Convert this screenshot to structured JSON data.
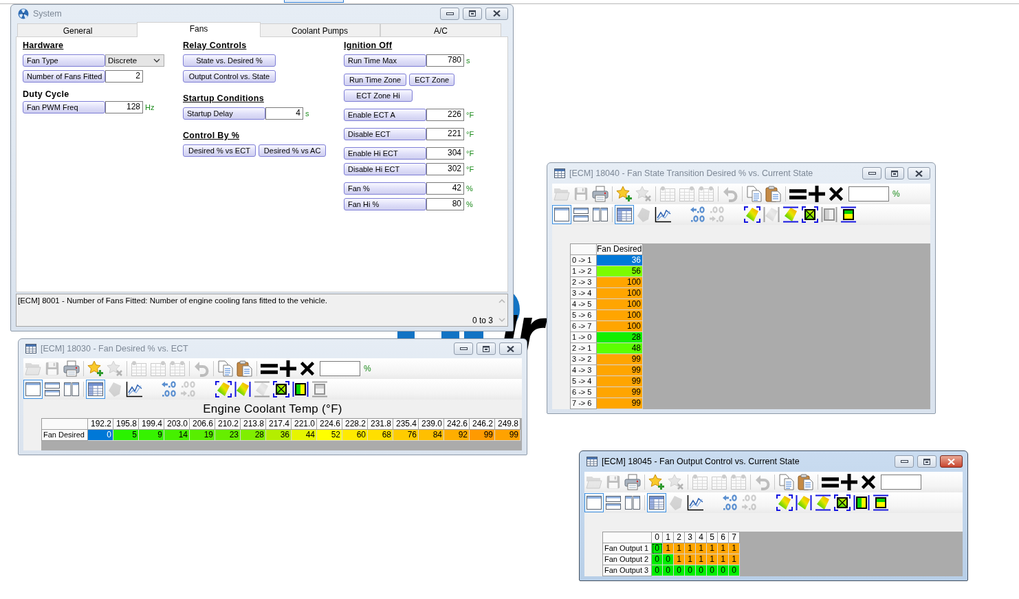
{
  "windows": [
    {
      "kind": "form",
      "title": "System",
      "active": false,
      "tabs": [
        {
          "label": "General",
          "selected": false
        },
        {
          "label": "Fans",
          "selected": true
        },
        {
          "label": "Coolant Pumps",
          "selected": false
        },
        {
          "label": "A/C",
          "selected": false
        }
      ],
      "columns": [
        {
          "groups": [
            {
              "heading": {
                "text": "Hardware",
                "underlined": true
              },
              "rows": [
                {
                  "kind": "dropdown",
                  "label": "Fan Type",
                  "value": "Discrete"
                },
                {
                  "kind": "field",
                  "label": "Number of Fans Fitted",
                  "value": "2"
                }
              ]
            },
            {
              "heading": {
                "text": "Duty Cycle",
                "underlined": false
              },
              "rows": [
                {
                  "kind": "field",
                  "label": "Fan PWM Freq",
                  "value": "128",
                  "unit": "Hz"
                }
              ]
            }
          ]
        },
        {
          "groups": [
            {
              "heading": {
                "text": "Relay Controls",
                "underlined": true
              },
              "rows": [
                {
                  "kind": "buttons",
                  "labels": [
                    "State vs. Desired %"
                  ]
                },
                {
                  "kind": "buttons",
                  "labels": [
                    "Output Control vs. State"
                  ]
                }
              ]
            },
            {
              "heading": {
                "text": "Startup Conditions",
                "underlined": true
              },
              "rows": [
                {
                  "kind": "field",
                  "label": "Startup Delay",
                  "value": "4",
                  "unit": "s"
                }
              ]
            },
            {
              "heading": {
                "text": "Control By %",
                "underlined": true
              },
              "rows": [
                {
                  "kind": "buttons",
                  "labels": [
                    "Desired % vs ECT",
                    "Desired % vs AC"
                  ]
                }
              ]
            }
          ]
        },
        {
          "groups": [
            {
              "heading": {
                "text": "Ignition Off",
                "underlined": true
              },
              "rows": [
                {
                  "kind": "field",
                  "label": "Run Time Max",
                  "value": "780",
                  "unit": "s"
                }
              ]
            },
            {
              "rows": [
                {
                  "kind": "buttons",
                  "labels": [
                    "Run Time Zone",
                    "ECT Zone"
                  ]
                },
                {
                  "kind": "buttons",
                  "labels": [
                    "ECT Zone Hi"
                  ]
                }
              ]
            },
            {
              "rows": [
                {
                  "kind": "field",
                  "label": "Enable ECT A",
                  "value": "226",
                  "unit": "°F"
                }
              ]
            },
            {
              "rows": [
                {
                  "kind": "field",
                  "label": "Disable ECT",
                  "value": "221",
                  "unit": "°F"
                }
              ]
            },
            {
              "rows": [
                {
                  "kind": "field",
                  "label": "Enable Hi ECT",
                  "value": "304",
                  "unit": "°F"
                },
                {
                  "kind": "field",
                  "label": "Disable Hi ECT",
                  "value": "302",
                  "unit": "°F"
                }
              ]
            },
            {
              "rows": [
                {
                  "kind": "field",
                  "label": "Fan %",
                  "value": "42",
                  "unit": "%"
                },
                {
                  "kind": "field",
                  "label": "Fan Hi %",
                  "value": "80",
                  "unit": "%"
                }
              ]
            }
          ]
        }
      ],
      "description": {
        "text": "[ECM] 8001 - Number of Fans Fitted: Number of engine cooling fans fitted to the vehicle.",
        "range": "0 to 3"
      }
    },
    {
      "kind": "table",
      "title": "[ECM] 18030 - Fan Desired % vs. ECT",
      "active": false,
      "toolbar_rows": [
        {
          "groups": [
            {
              "items": [
                {
                  "kind": "open",
                  "disabled": true
                },
                {
                  "kind": "save",
                  "disabled": true
                },
                {
                  "kind": "print",
                  "disabled": false
                }
              ]
            },
            {
              "items": [
                {
                  "kind": "add_favorite",
                  "disabled": false
                },
                {
                  "kind": "remove_favorite",
                  "disabled": true
                }
              ]
            },
            {
              "items": [
                {
                  "kind": "grid_a",
                  "disabled": true
                },
                {
                  "kind": "grid_b",
                  "disabled": true
                },
                {
                  "kind": "grid_c",
                  "disabled": true
                }
              ]
            },
            {
              "items": [
                {
                  "kind": "undo",
                  "disabled": true
                }
              ]
            },
            {
              "items": [
                {
                  "kind": "copy",
                  "disabled": false
                },
                {
                  "kind": "paste",
                  "disabled": false
                }
              ]
            },
            {
              "items": [
                {
                  "kind": "set",
                  "disabled": false
                },
                {
                  "kind": "add",
                  "disabled": false
                },
                {
                  "kind": "multiply",
                  "disabled": false
                },
                {
                  "kind": "input",
                  "disabled": false,
                  "unit": "%"
                }
              ]
            }
          ]
        },
        {
          "groups": [
            {
              "items": [
                {
                  "kind": "single_pane",
                  "disabled": false,
                  "selected": true
                },
                {
                  "kind": "stacked_panes",
                  "disabled": false,
                  "selected": false
                },
                {
                  "kind": "side_panes",
                  "disabled": false,
                  "selected": false
                }
              ]
            },
            {
              "items": [
                {
                  "kind": "table_view",
                  "disabled": false,
                  "selected": true
                },
                {
                  "kind": "surface_view",
                  "disabled": true,
                  "selected": false
                },
                {
                  "kind": "chart_view",
                  "disabled": false,
                  "selected": false
                }
              ]
            },
            {
              "items": [
                {
                  "kind": "decimal_more",
                  "disabled": false
                },
                {
                  "kind": "decimal_less",
                  "disabled": true
                }
              ]
            },
            {
              "items": [
                {
                  "kind": "fit_all",
                  "disabled": false
                },
                {
                  "kind": "fit_sides",
                  "disabled": false
                },
                {
                  "kind": "fit_top_bottom",
                  "disabled": true
                },
                {
                  "kind": "cross_box",
                  "disabled": false
                },
                {
                  "kind": "bar_sides",
                  "disabled": false
                },
                {
                  "kind": "bar_top_bottom",
                  "disabled": true
                }
              ]
            }
          ]
        }
      ],
      "axis_title": "Engine Coolant Temp (°F)",
      "table": {
        "columns": [
          "192.2",
          "195.8",
          "199.4",
          "203.0",
          "206.6",
          "210.2",
          "213.8",
          "217.4",
          "221.0",
          "224.6",
          "228.2",
          "231.8",
          "235.4",
          "239.0",
          "242.6",
          "246.2",
          "249.8"
        ],
        "rows": [
          {
            "label": "Fan Desired",
            "cells": [
              {
                "value": "0",
                "selected": true
              },
              {
                "value": "5",
                "color": "#2af200",
                "selected": false
              },
              {
                "value": "9",
                "color": "#36f200",
                "selected": false
              },
              {
                "value": "14",
                "color": "#46f000",
                "selected": false
              },
              {
                "value": "19",
                "color": "#58ee00",
                "selected": false
              },
              {
                "value": "23",
                "color": "#66ee00",
                "selected": false
              },
              {
                "value": "28",
                "color": "#80ee00",
                "selected": false
              },
              {
                "value": "36",
                "color": "#b4ee00",
                "selected": false
              },
              {
                "value": "44",
                "color": "#e6f500",
                "selected": false
              },
              {
                "value": "52",
                "color": "#ffff00",
                "selected": false
              },
              {
                "value": "60",
                "color": "#ffea00",
                "selected": false
              },
              {
                "value": "68",
                "color": "#ffdf00",
                "selected": false
              },
              {
                "value": "76",
                "color": "#ffcc00",
                "selected": false
              },
              {
                "value": "84",
                "color": "#ffbf00",
                "selected": false
              },
              {
                "value": "92",
                "color": "#ffae00",
                "selected": false
              },
              {
                "value": "99",
                "color": "#ff9a00",
                "selected": false
              },
              {
                "value": "99",
                "color": "#ffa200",
                "selected": false
              }
            ]
          }
        ]
      }
    },
    {
      "kind": "table",
      "title": "[ECM] 18040 - Fan State Transition Desired % vs. Current State",
      "active": false,
      "toolbar_rows": [
        {
          "groups": [
            {
              "items": [
                {
                  "kind": "open",
                  "disabled": true
                },
                {
                  "kind": "save",
                  "disabled": true
                },
                {
                  "kind": "print",
                  "disabled": false
                }
              ]
            },
            {
              "items": [
                {
                  "kind": "add_favorite",
                  "disabled": false
                },
                {
                  "kind": "remove_favorite",
                  "disabled": true
                }
              ]
            },
            {
              "items": [
                {
                  "kind": "grid_a",
                  "disabled": true
                },
                {
                  "kind": "grid_b",
                  "disabled": true
                },
                {
                  "kind": "grid_c",
                  "disabled": true
                }
              ]
            },
            {
              "items": [
                {
                  "kind": "undo",
                  "disabled": true
                }
              ]
            },
            {
              "items": [
                {
                  "kind": "copy",
                  "disabled": false
                },
                {
                  "kind": "paste",
                  "disabled": false
                }
              ]
            },
            {
              "items": [
                {
                  "kind": "set",
                  "disabled": false
                },
                {
                  "kind": "add",
                  "disabled": false
                },
                {
                  "kind": "multiply",
                  "disabled": false
                },
                {
                  "kind": "input",
                  "disabled": false,
                  "unit": "%"
                }
              ]
            }
          ]
        },
        {
          "groups": [
            {
              "items": [
                {
                  "kind": "single_pane",
                  "disabled": false,
                  "selected": true
                },
                {
                  "kind": "stacked_panes",
                  "disabled": false,
                  "selected": false
                },
                {
                  "kind": "side_panes",
                  "disabled": false,
                  "selected": false
                }
              ]
            },
            {
              "items": [
                {
                  "kind": "table_view",
                  "disabled": false,
                  "selected": true
                },
                {
                  "kind": "surface_view",
                  "disabled": true,
                  "selected": false
                },
                {
                  "kind": "chart_view",
                  "disabled": false,
                  "selected": false
                }
              ]
            },
            {
              "items": [
                {
                  "kind": "decimal_more",
                  "disabled": false
                },
                {
                  "kind": "decimal_less",
                  "disabled": true
                }
              ]
            },
            {
              "items": [
                {
                  "kind": "fit_all",
                  "disabled": false
                },
                {
                  "kind": "fit_sides",
                  "disabled": true
                },
                {
                  "kind": "fit_top_bottom",
                  "disabled": false
                },
                {
                  "kind": "cross_box",
                  "disabled": false
                },
                {
                  "kind": "bar_sides",
                  "disabled": true
                },
                {
                  "kind": "bar_top_bottom",
                  "disabled": false
                }
              ]
            }
          ]
        }
      ],
      "table": {
        "columns": [
          "Fan Desired"
        ],
        "rows": [
          {
            "label": "0 -> 1",
            "cells": [
              {
                "value": "36",
                "selected": true
              }
            ]
          },
          {
            "label": "1 -> 2",
            "cells": [
              {
                "value": "56",
                "color": "#7cfc00",
                "selected": false
              }
            ]
          },
          {
            "label": "2 -> 3",
            "cells": [
              {
                "value": "100",
                "color": "#ffa500",
                "selected": false
              }
            ]
          },
          {
            "label": "3 -> 4",
            "cells": [
              {
                "value": "100",
                "color": "#ffa500",
                "selected": false
              }
            ]
          },
          {
            "label": "4 -> 5",
            "cells": [
              {
                "value": "100",
                "color": "#ffa500",
                "selected": false
              }
            ]
          },
          {
            "label": "5 -> 6",
            "cells": [
              {
                "value": "100",
                "color": "#ffa500",
                "selected": false
              }
            ]
          },
          {
            "label": "6 -> 7",
            "cells": [
              {
                "value": "100",
                "color": "#ffa500",
                "selected": false
              }
            ]
          },
          {
            "label": "1 -> 0",
            "cells": [
              {
                "value": "28",
                "color": "#14ee00",
                "selected": false
              }
            ]
          },
          {
            "label": "2 -> 1",
            "cells": [
              {
                "value": "48",
                "color": "#5cff00",
                "selected": false
              }
            ]
          },
          {
            "label": "3 -> 2",
            "cells": [
              {
                "value": "99",
                "color": "#ffa500",
                "selected": false
              }
            ]
          },
          {
            "label": "4 -> 3",
            "cells": [
              {
                "value": "99",
                "color": "#ffa500",
                "selected": false
              }
            ]
          },
          {
            "label": "5 -> 4",
            "cells": [
              {
                "value": "99",
                "color": "#ffa500",
                "selected": false
              }
            ]
          },
          {
            "label": "6 -> 5",
            "cells": [
              {
                "value": "99",
                "color": "#ffa500",
                "selected": false
              }
            ]
          },
          {
            "label": "7 -> 6",
            "cells": [
              {
                "value": "99",
                "color": "#ffa500",
                "selected": false
              }
            ]
          }
        ]
      }
    },
    {
      "kind": "table",
      "title": "[ECM] 18045 - Fan Output Control vs. Current State",
      "active": true,
      "toolbar_rows": [
        {
          "groups": [
            {
              "items": [
                {
                  "kind": "open",
                  "disabled": true
                },
                {
                  "kind": "save",
                  "disabled": true
                },
                {
                  "kind": "print",
                  "disabled": false
                }
              ]
            },
            {
              "items": [
                {
                  "kind": "add_favorite",
                  "disabled": false
                },
                {
                  "kind": "remove_favorite",
                  "disabled": true
                }
              ]
            },
            {
              "items": [
                {
                  "kind": "grid_a",
                  "disabled": true
                },
                {
                  "kind": "grid_b",
                  "disabled": true
                },
                {
                  "kind": "grid_c",
                  "disabled": true
                }
              ]
            },
            {
              "items": [
                {
                  "kind": "undo",
                  "disabled": true
                }
              ]
            },
            {
              "items": [
                {
                  "kind": "copy",
                  "disabled": false
                },
                {
                  "kind": "paste",
                  "disabled": false
                }
              ]
            },
            {
              "items": [
                {
                  "kind": "set",
                  "disabled": false
                },
                {
                  "kind": "add",
                  "disabled": false
                },
                {
                  "kind": "multiply",
                  "disabled": false
                },
                {
                  "kind": "input",
                  "disabled": false
                }
              ]
            }
          ]
        },
        {
          "groups": [
            {
              "items": [
                {
                  "kind": "single_pane",
                  "disabled": false,
                  "selected": true
                },
                {
                  "kind": "stacked_panes",
                  "disabled": false,
                  "selected": false
                },
                {
                  "kind": "side_panes",
                  "disabled": false,
                  "selected": false
                }
              ]
            },
            {
              "items": [
                {
                  "kind": "table_view",
                  "disabled": false,
                  "selected": true
                },
                {
                  "kind": "surface_view",
                  "disabled": true,
                  "selected": false
                },
                {
                  "kind": "chart_view",
                  "disabled": false,
                  "selected": false
                }
              ]
            },
            {
              "items": [
                {
                  "kind": "decimal_more",
                  "disabled": false
                },
                {
                  "kind": "decimal_less",
                  "disabled": true
                }
              ]
            },
            {
              "items": [
                {
                  "kind": "fit_all",
                  "disabled": false
                },
                {
                  "kind": "fit_sides",
                  "disabled": false
                },
                {
                  "kind": "fit_top_bottom",
                  "disabled": false
                },
                {
                  "kind": "cross_box",
                  "disabled": false
                },
                {
                  "kind": "bar_sides",
                  "disabled": false
                },
                {
                  "kind": "bar_top_bottom",
                  "disabled": false
                }
              ]
            }
          ]
        }
      ],
      "table": {
        "columns": [
          "0",
          "1",
          "2",
          "3",
          "4",
          "5",
          "6",
          "7"
        ],
        "rows": [
          {
            "label": "Fan Output 1",
            "cells": [
              {
                "value": "0",
                "color": "#00ee00",
                "focused": true
              },
              {
                "value": "1",
                "color": "#ffa500",
                "focused": false
              },
              {
                "value": "1",
                "color": "#ffa500",
                "focused": false
              },
              {
                "value": "1",
                "color": "#ffa500",
                "focused": false
              },
              {
                "value": "1",
                "color": "#ffa500",
                "focused": false
              },
              {
                "value": "1",
                "color": "#ffa500",
                "focused": false
              },
              {
                "value": "1",
                "color": "#ffa500",
                "focused": false
              },
              {
                "value": "1",
                "color": "#ffa500",
                "focused": false
              }
            ]
          },
          {
            "label": "Fan Output 2",
            "cells": [
              {
                "value": "0",
                "color": "#00ee00",
                "focused": false
              },
              {
                "value": "0",
                "color": "#00ee00",
                "focused": false
              },
              {
                "value": "1",
                "color": "#ffa500",
                "focused": false
              },
              {
                "value": "1",
                "color": "#ffa500",
                "focused": false
              },
              {
                "value": "1",
                "color": "#ffa500",
                "focused": false
              },
              {
                "value": "1",
                "color": "#ffa500",
                "focused": false
              },
              {
                "value": "1",
                "color": "#ffa500",
                "focused": false
              },
              {
                "value": "1",
                "color": "#ffa500",
                "focused": false
              }
            ]
          },
          {
            "label": "Fan Output 3",
            "cells": [
              {
                "value": "0",
                "color": "#00ee00",
                "focused": false
              },
              {
                "value": "0",
                "color": "#00ee00",
                "focused": false
              },
              {
                "value": "0",
                "color": "#00ee00",
                "focused": false
              },
              {
                "value": "0",
                "color": "#00ee00",
                "focused": false
              },
              {
                "value": "0",
                "color": "#00ee00",
                "focused": false
              },
              {
                "value": "0",
                "color": "#00ee00",
                "focused": false
              },
              {
                "value": "0",
                "color": "#00ee00",
                "focused": false
              },
              {
                "value": "0",
                "color": "#00ee00",
                "focused": false
              }
            ]
          }
        ]
      }
    }
  ]
}
